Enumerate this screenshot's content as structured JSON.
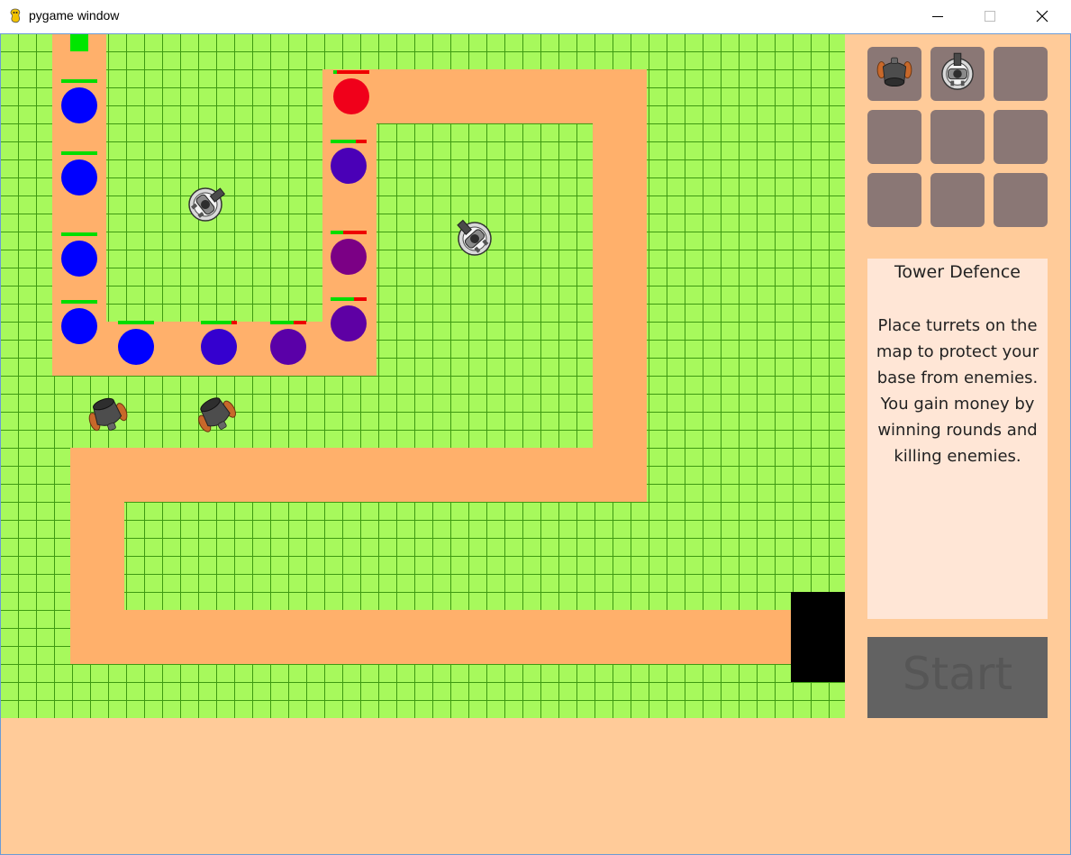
{
  "window": {
    "title": "pygame window",
    "icon": "pygame-snake-icon",
    "controls": [
      "minimize-icon",
      "maximize-icon",
      "close-icon"
    ]
  },
  "colors": {
    "grass": "#a7f95c",
    "grid_line": "#3e9a12",
    "path": "#ffb06b",
    "panel": "#ffcb99",
    "slot": "#8a7775",
    "info_bg": "#ffe6d6",
    "start_bg": "#626262",
    "start_text": "#565656",
    "base": "#000000",
    "spawn": "#00e600",
    "health_full": "#00dd00",
    "health_lost": "#ee0000"
  },
  "game": {
    "enemies": [
      {
        "color": "#0000ff",
        "health": 1.0
      },
      {
        "color": "#0000ff",
        "health": 1.0
      },
      {
        "color": "#0000ff",
        "health": 1.0
      },
      {
        "color": "#0000ff",
        "health": 1.0
      },
      {
        "color": "#0000ff",
        "health": 1.0
      },
      {
        "color": "#3500cf",
        "health": 0.85
      },
      {
        "color": "#5a00a8",
        "health": 0.65
      },
      {
        "color": "#7b0085",
        "health": 0.35
      },
      {
        "color": "#5e00a4",
        "health": 0.65
      },
      {
        "color": "#4a00b7",
        "health": 0.7
      },
      {
        "color": "#f0001a",
        "health": 0.1
      }
    ],
    "turrets": [
      {
        "type": "machine-gun-turret"
      },
      {
        "type": "machine-gun-turret"
      },
      {
        "type": "cannon-turret"
      },
      {
        "type": "cannon-turret"
      }
    ]
  },
  "shop": {
    "slots": [
      {
        "item": "cannon-turret"
      },
      {
        "item": "machine-gun-turret"
      },
      {
        "item": ""
      },
      {
        "item": ""
      },
      {
        "item": ""
      },
      {
        "item": ""
      },
      {
        "item": ""
      },
      {
        "item": ""
      },
      {
        "item": ""
      }
    ]
  },
  "info": {
    "title": "Tower Defence",
    "body_lines": [
      "Place turrets on the",
      "map to protect your",
      "base from enemies.",
      "You gain money by",
      "winning rounds and",
      "killing enemies."
    ]
  },
  "start_button": {
    "label": "Start"
  }
}
